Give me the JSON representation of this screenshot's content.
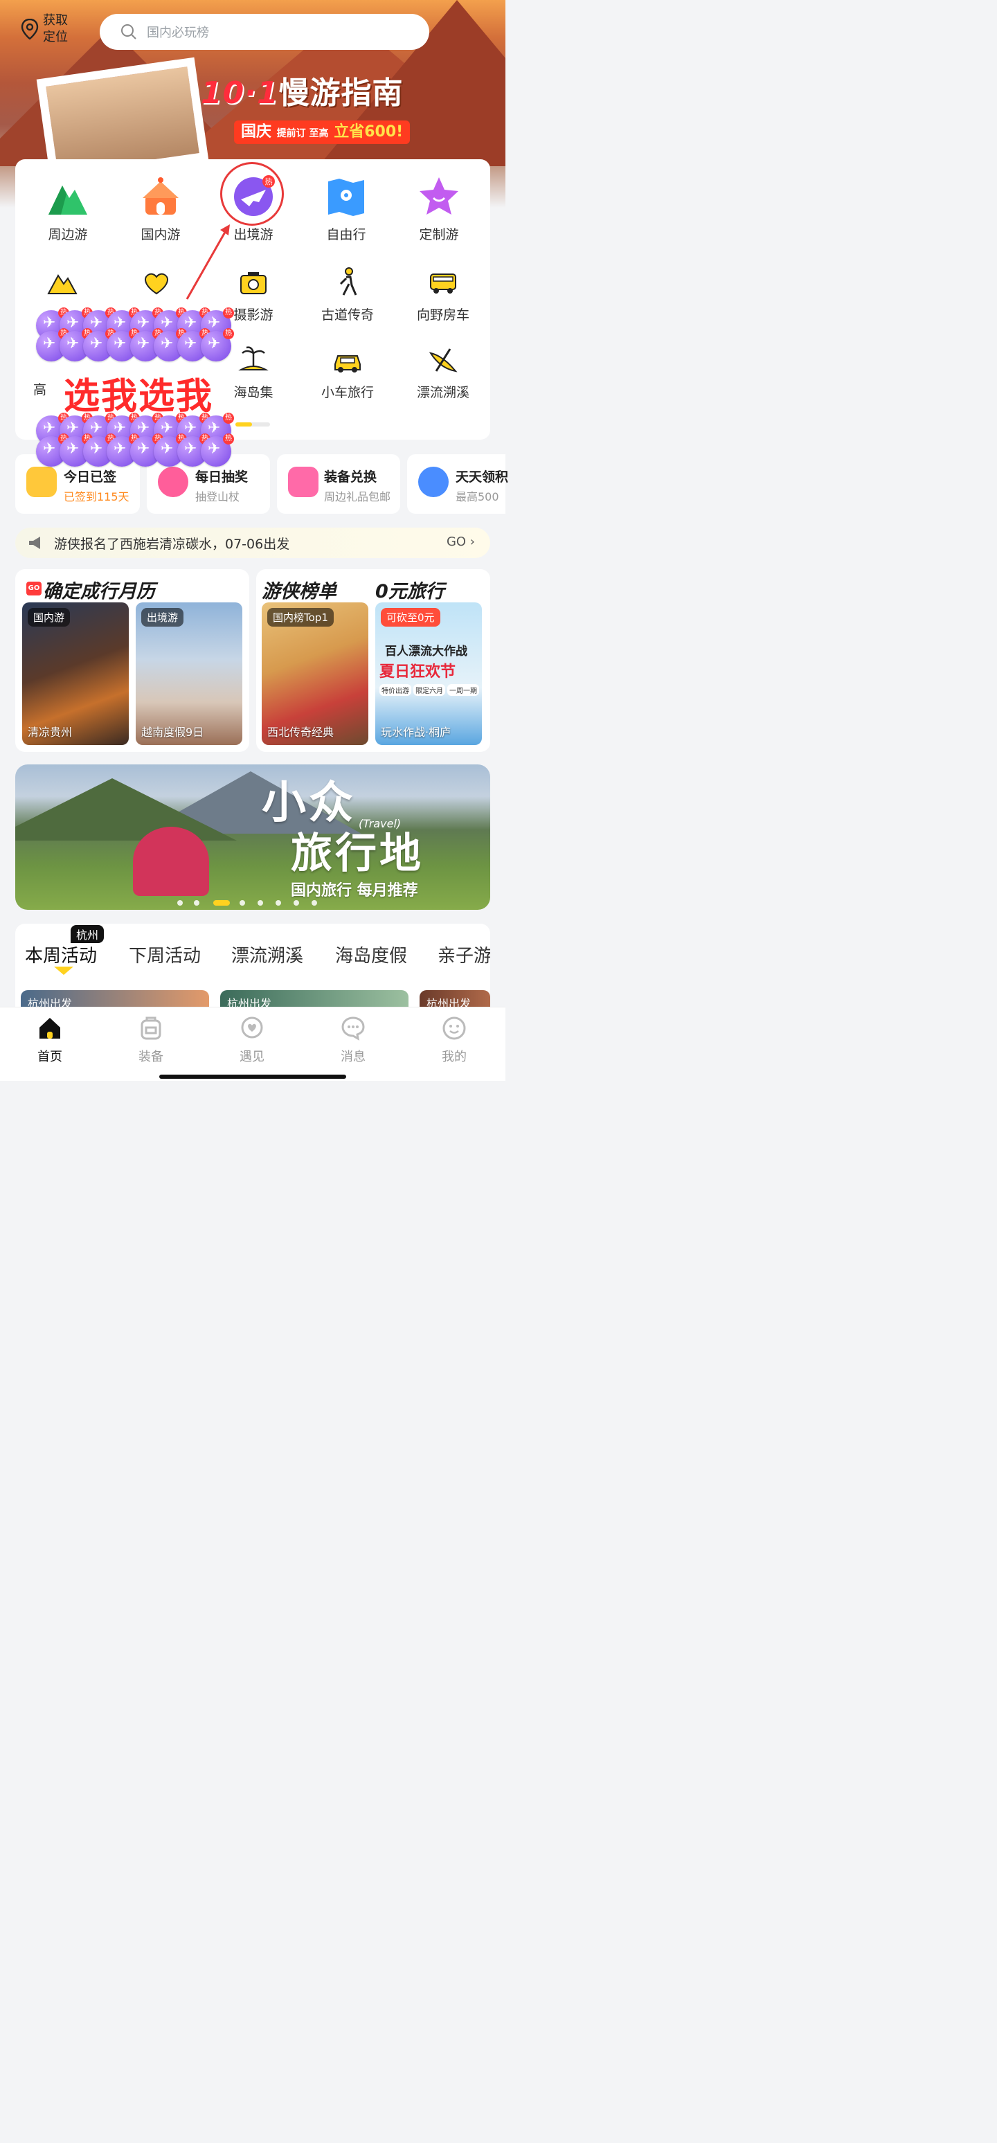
{
  "header": {
    "location_label": "获取\n定位",
    "search_placeholder": "国内必玩榜"
  },
  "hero": {
    "title_num": "10·1",
    "title_text": "慢游指南",
    "sub_big1": "国庆",
    "sub_small": "提前订 至高",
    "sub_big2": "立省600!"
  },
  "categories_row1": [
    {
      "label": "周边游",
      "icon": "green-mountain-icon"
    },
    {
      "label": "国内游",
      "icon": "temple-icon"
    },
    {
      "label": "出境游",
      "icon": "plane-icon",
      "badge": "热"
    },
    {
      "label": "自由行",
      "icon": "map-icon"
    },
    {
      "label": "定制游",
      "icon": "star-icon"
    }
  ],
  "categories_row2": [
    {
      "label": "",
      "icon": "mountain-outline-icon"
    },
    {
      "label": "",
      "icon": "heart-outline-icon"
    },
    {
      "label": "摄影游",
      "icon": "camera-icon"
    },
    {
      "label": "古道传奇",
      "icon": "hiker-icon"
    },
    {
      "label": "向野房车",
      "icon": "rv-icon"
    }
  ],
  "categories_row3": [
    {
      "label": "",
      "icon": ""
    },
    {
      "label": "",
      "icon": ""
    },
    {
      "label": "海岛集",
      "icon": "island-icon"
    },
    {
      "label": "小车旅行",
      "icon": "car-icon"
    },
    {
      "label": "漂流溯溪",
      "icon": "kayak-icon"
    }
  ],
  "overlay": {
    "pick_text": "选我选我",
    "hot_badge": "热"
  },
  "services": [
    {
      "title": "今日已签",
      "sub": "已签到115天"
    },
    {
      "title": "每日抽奖",
      "sub": "抽登山杖"
    },
    {
      "title": "装备兑换",
      "sub": "周边礼品包邮"
    },
    {
      "title": "天天领积",
      "sub": "最高500"
    }
  ],
  "notice": {
    "text": "游侠报名了西施岩清凉碳水，07-06出发",
    "go": "GO"
  },
  "features": {
    "calendar_title": "确定成行月历",
    "calendar_badge": "GO",
    "calendar_items": [
      {
        "tag": "国内游",
        "caption": "清凉贵州"
      },
      {
        "tag": "出境游",
        "caption": "越南度假9日"
      }
    ],
    "rank_title": "游侠榜单",
    "rank_item": {
      "tag": "国内榜Top1",
      "caption": "西北传奇经典"
    },
    "free_title": "0元旅行",
    "free_item": {
      "tag": "可砍至0元",
      "caption": "玩水作战·桐庐",
      "poster_line1": "百人漂流大作战",
      "poster_line2": "夏日狂欢节",
      "poster_chip1": "特价出游",
      "poster_chip2": "限定六月",
      "poster_chip3": "一周一期"
    }
  },
  "banner": {
    "line1": "小众",
    "travel": "(Travel)",
    "line2": "旅行地",
    "sub": "国内旅行 每月推荐"
  },
  "tabs": {
    "city": "杭州",
    "items": [
      "本周活动",
      "下周活动",
      "漂流溯溪",
      "海岛度假",
      "亲子游"
    ]
  },
  "strips": [
    "杭州出发",
    "杭州出发",
    "杭州出发"
  ],
  "bottom_nav": [
    {
      "label": "首页",
      "icon": "home-icon",
      "active": true
    },
    {
      "label": "装备",
      "icon": "backpack-icon"
    },
    {
      "label": "遇见",
      "icon": "location-heart-icon"
    },
    {
      "label": "消息",
      "icon": "chat-icon"
    },
    {
      "label": "我的",
      "icon": "smile-icon"
    }
  ],
  "colors": {
    "accent_yellow": "#ffd21f",
    "hot_red": "#ff3b3b",
    "plane_purple": "#8a57f0"
  }
}
